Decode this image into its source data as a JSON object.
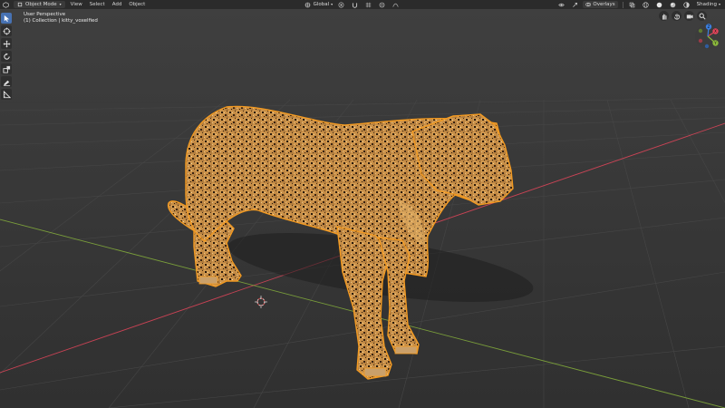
{
  "header": {
    "mode_label": "Object Mode",
    "menus": [
      "View",
      "Select",
      "Add",
      "Object"
    ],
    "orientation_label": "Global",
    "overlays_label": "Overlays",
    "shading_label": "Shading"
  },
  "viewport": {
    "view_name": "User Perspective",
    "collection_info": "(1) Collection | kitty_voxelfied"
  },
  "toolbar": {
    "tools": [
      {
        "name": "select-tool",
        "icon": "cursor-icon",
        "active": true
      },
      {
        "name": "cursor-tool",
        "icon": "3d-cursor-icon",
        "active": false
      },
      {
        "name": "move-tool",
        "icon": "move-icon",
        "active": false
      },
      {
        "name": "rotate-tool",
        "icon": "rotate-icon",
        "active": false
      },
      {
        "name": "scale-tool",
        "icon": "scale-icon",
        "active": false
      },
      {
        "name": "annotate-tool",
        "icon": "annotate-icon",
        "active": false
      },
      {
        "name": "measure-tool",
        "icon": "measure-icon",
        "active": false
      }
    ]
  },
  "gizmo": {
    "x_label": "X",
    "y_label": "Y",
    "z_label": "Z"
  },
  "colors": {
    "header_bg": "#2b2b2b",
    "viewport_bg": "#3d3d3d",
    "accent_blue": "#4772b3",
    "selection_outline": "#f29a22",
    "axis_x": "#e2455a",
    "axis_y": "#8bb83c",
    "axis_z": "#3b7fe0"
  }
}
